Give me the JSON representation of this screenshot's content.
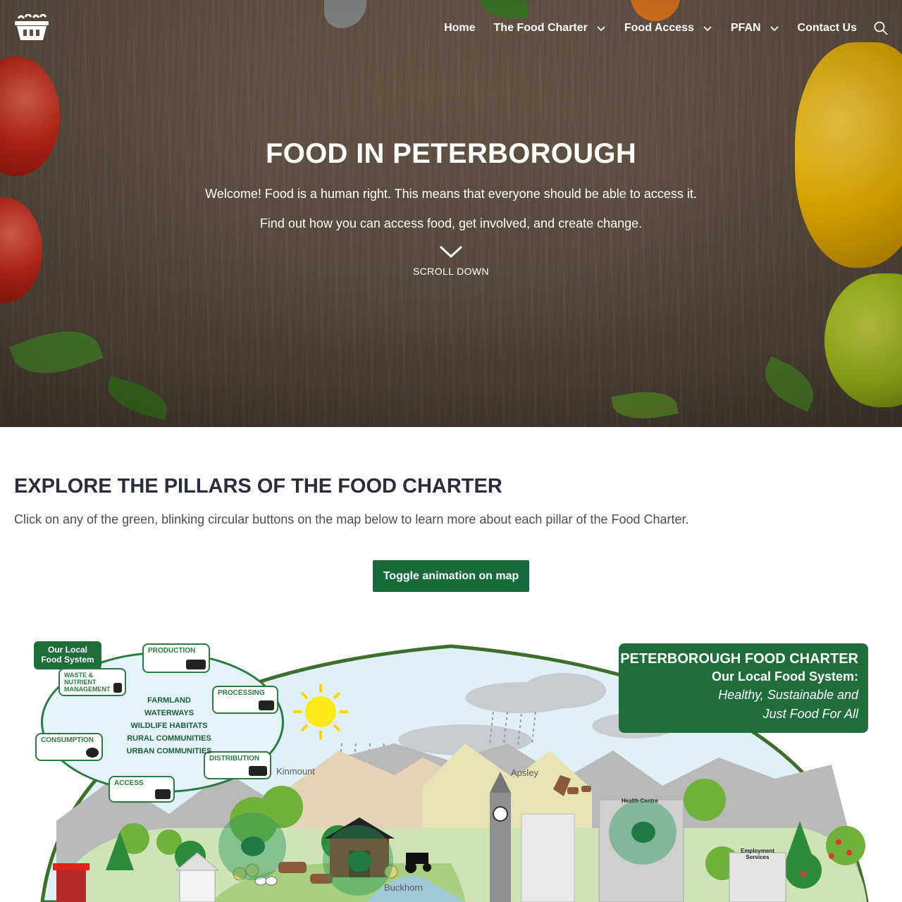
{
  "nav": {
    "logo_icon": "food-basket-icon",
    "items": [
      {
        "label": "Home",
        "dropdown": false
      },
      {
        "label": "The Food Charter",
        "dropdown": true
      },
      {
        "label": "Food Access",
        "dropdown": true
      },
      {
        "label": "PFAN",
        "dropdown": true
      },
      {
        "label": "Contact Us",
        "dropdown": false
      }
    ],
    "search_icon": "search-icon"
  },
  "hero": {
    "title": "FOOD IN PETERBOROUGH",
    "line1": "Welcome! Food is a human right. This means that everyone should be able to access it.",
    "line2": "Find out how you can access food, get involved, and create change.",
    "scroll_label": "SCROLL DOWN"
  },
  "explore": {
    "title": "EXPLORE THE PILLARS OF THE FOOD CHARTER",
    "text": "Click on any of the green, blinking circular buttons on the map below to learn more about each pillar of the Food Charter.",
    "toggle_label": "Toggle animation on map"
  },
  "map": {
    "system_title_1": "Our Local",
    "system_title_2": "Food System",
    "cycle": {
      "production": "PRODUCTION",
      "processing": "PROCESSING",
      "distribution": "DISTRIBUTION",
      "access": "ACCESS",
      "consumption": "CONSUMPTION",
      "waste_1": "WASTE &",
      "waste_2": "NUTRIENT",
      "waste_3": "MANAGEMENT"
    },
    "land": [
      "FARMLAND",
      "WATERWAYS",
      "WILDLIFE HABITATS",
      "RURAL COMMUNITIES",
      "URBAN COMMUNITIES"
    ],
    "charter": {
      "title": "PETERBOROUGH FOOD CHARTER",
      "subtitle": "Our Local Food System:",
      "tagline_1": "Healthy, Sustainable and",
      "tagline_2": "Just Food For All"
    },
    "places": {
      "kinmount": "Kinmount",
      "apsley": "Apsley",
      "buckhorn": "Buckhorn"
    },
    "buildings": {
      "health": "Health Centre",
      "employment_1": "Employment",
      "employment_2": "Services"
    }
  },
  "colors": {
    "brand_green": "#176b3b",
    "charter_green": "#1f6e3a",
    "heading": "#2b2d3a"
  }
}
